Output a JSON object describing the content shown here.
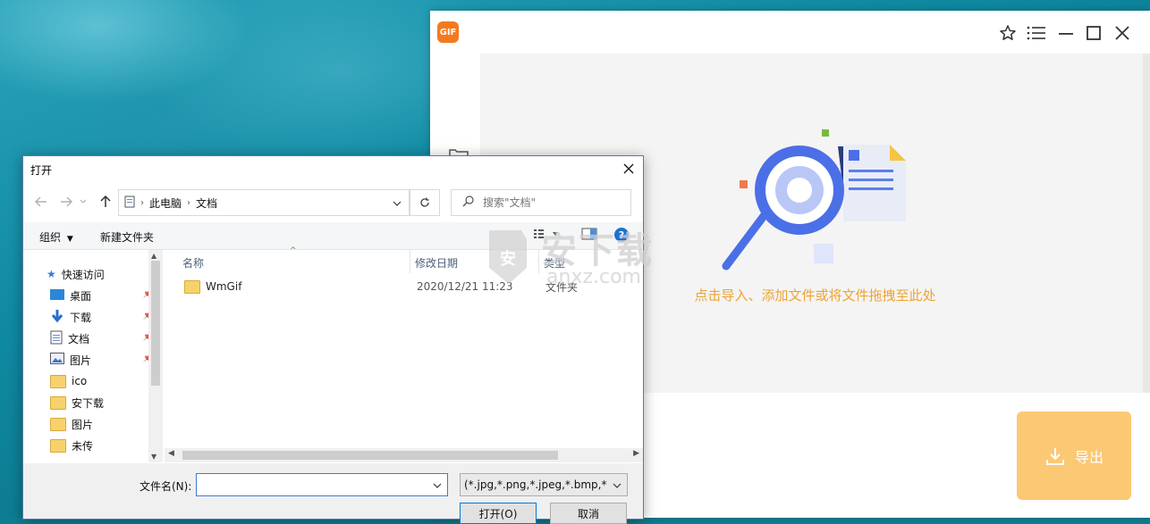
{
  "app": {
    "logo_text": "GIF",
    "drop_hint": "点击导入、添加文件或将文件拖拽至此处",
    "export_label": "导出",
    "colors": {
      "accent": "#f0a22f",
      "export_bg": "#fbc874",
      "logo_bg": "#f47a1f"
    }
  },
  "dialog": {
    "title": "打开",
    "breadcrumb": [
      "此电脑",
      "文档"
    ],
    "search_placeholder": "搜索\"文档\"",
    "toolbar": {
      "organize": "组织",
      "new_folder": "新建文件夹"
    },
    "tree": [
      {
        "label": "快速访问",
        "icon": "star-icon",
        "pinned": false
      },
      {
        "label": "桌面",
        "icon": "desktop-icon",
        "pinned": true
      },
      {
        "label": "下载",
        "icon": "download-arrow-icon",
        "pinned": true
      },
      {
        "label": "文档",
        "icon": "document-icon",
        "pinned": true
      },
      {
        "label": "图片",
        "icon": "picture-icon",
        "pinned": true
      },
      {
        "label": "ico",
        "icon": "folder-icon",
        "pinned": false
      },
      {
        "label": "安下载",
        "icon": "folder-icon",
        "pinned": false
      },
      {
        "label": "图片",
        "icon": "folder-icon",
        "pinned": false
      },
      {
        "label": "未传",
        "icon": "folder-icon",
        "pinned": false
      }
    ],
    "columns": {
      "name": "名称",
      "modified": "修改日期",
      "type": "类型"
    },
    "files": [
      {
        "name": "WmGif",
        "modified": "2020/12/21 11:23",
        "type": "文件夹"
      }
    ],
    "filename_label": "文件名(N):",
    "filename_value": "",
    "filetype": "(*.jpg,*.png,*.jpeg,*.bmp,*.gif)",
    "open_label": "打开(O)",
    "cancel_label": "取消"
  },
  "watermark": {
    "text": "安下载",
    "sub": "anxz.com"
  }
}
